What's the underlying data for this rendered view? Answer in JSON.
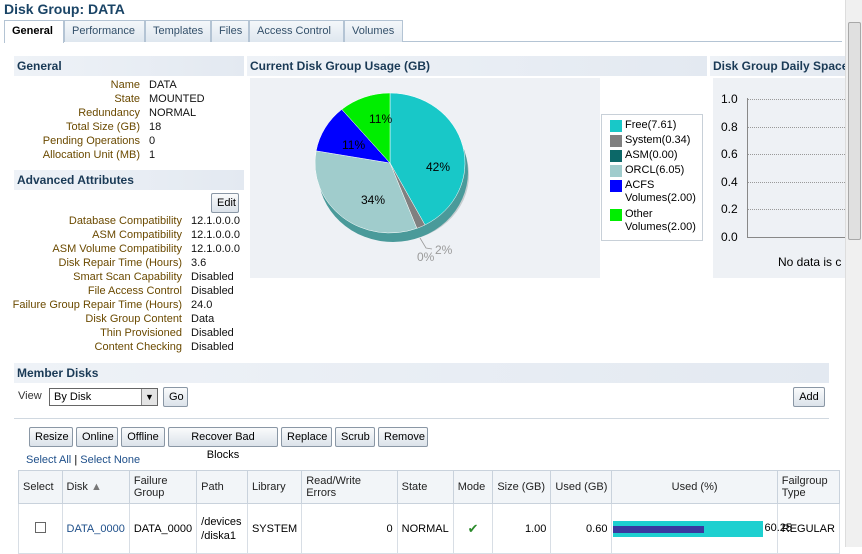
{
  "page": {
    "title": "Disk Group: DATA"
  },
  "tabs": [
    "General",
    "Performance",
    "Templates",
    "Files",
    "Access Control",
    "Volumes"
  ],
  "general": {
    "header": "General",
    "rows": [
      {
        "label": "Name",
        "value": "DATA"
      },
      {
        "label": "State",
        "value": "MOUNTED"
      },
      {
        "label": "Redundancy",
        "value": "NORMAL"
      },
      {
        "label": "Total Size (GB)",
        "value": "18"
      },
      {
        "label": "Pending Operations",
        "value": "0"
      },
      {
        "label": "Allocation Unit (MB)",
        "value": "1"
      }
    ]
  },
  "advanced": {
    "header": "Advanced Attributes",
    "edit_label": "Edit",
    "rows": [
      {
        "label": "Database Compatibility",
        "value": "12.1.0.0.0"
      },
      {
        "label": "ASM Compatibility",
        "value": "12.1.0.0.0"
      },
      {
        "label": "ASM Volume Compatibility",
        "value": "12.1.0.0.0"
      },
      {
        "label": "Disk Repair Time (Hours)",
        "value": "3.6"
      },
      {
        "label": "Smart Scan Capability",
        "value": "Disabled"
      },
      {
        "label": "File Access Control",
        "value": "Disabled"
      },
      {
        "label": "Failure Group Repair Time (Hours)",
        "value": "24.0"
      },
      {
        "label": "Disk Group Content",
        "value": "Data"
      },
      {
        "label": "Thin Provisioned",
        "value": "Disabled"
      },
      {
        "label": "Content Checking",
        "value": "Disabled"
      }
    ]
  },
  "usage": {
    "header": "Current Disk Group Usage (GB)",
    "slice_labels": {
      "free": "42%",
      "orcl": "34%",
      "asm_zero": "0%",
      "system": "2%",
      "acfs": "11%",
      "other": "11%"
    },
    "legend": [
      {
        "label": "Free(7.61)",
        "color": "#18c8c8"
      },
      {
        "label": "System(0.34)",
        "color": "#808080"
      },
      {
        "label": "ASM(0.00)",
        "color": "#0c6868"
      },
      {
        "label": "ORCL(6.05)",
        "color": "#a0cccc"
      },
      {
        "label": "ACFS Volumes(2.00)",
        "color": "#0000ff"
      },
      {
        "label": "Other Volumes(2.00)",
        "color": "#00ee00"
      }
    ]
  },
  "daily": {
    "header": "Disk Group Daily Space",
    "y_ticks": [
      "1.0",
      "0.8",
      "0.6",
      "0.4",
      "0.2",
      "0.0"
    ],
    "empty_text": "No data is c"
  },
  "chart_data": {
    "type": "pie",
    "title": "Current Disk Group Usage (GB)",
    "categories": [
      "Free",
      "System",
      "ASM",
      "ORCL",
      "ACFS Volumes",
      "Other Volumes"
    ],
    "values": [
      7.61,
      0.34,
      0.0,
      6.05,
      2.0,
      2.0
    ],
    "percent_labels": [
      "42%",
      "2%",
      "0%",
      "34%",
      "11%",
      "11%"
    ],
    "colors": [
      "#18c8c8",
      "#808080",
      "#0c6868",
      "#a0cccc",
      "#0000ff",
      "#00ee00"
    ],
    "legend_position": "right"
  },
  "member": {
    "header": "Member Disks",
    "view_label": "View",
    "view_value": "By Disk",
    "go_label": "Go",
    "add_label": "Add",
    "actions": [
      "Resize",
      "Online",
      "Offline",
      "Recover Bad Blocks",
      "Replace",
      "Scrub",
      "Remove"
    ],
    "select_all": "Select All",
    "select_none": "Select None",
    "separator": "|",
    "columns": [
      "Select",
      "Disk",
      "Failure Group",
      "Path",
      "Library",
      "Read/Write Errors",
      "State",
      "Mode",
      "Size (GB)",
      "Used (GB)",
      "Used (%)",
      "Failgroup Type"
    ],
    "rows": [
      {
        "disk": "DATA_0000",
        "failure_group": "DATA_0000",
        "path": "/devices /diska1",
        "library": "SYSTEM",
        "rw_errors": "0",
        "state": "NORMAL",
        "mode": "✔",
        "size": "1.00",
        "used": "0.60",
        "used_pct": 60.25,
        "used_pct_label": "60.25",
        "failgroup_type": "REGULAR"
      }
    ]
  }
}
